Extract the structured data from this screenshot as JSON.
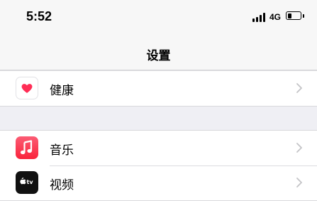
{
  "status_bar": {
    "time": "5:52",
    "network": "4G",
    "signal_bars": 4,
    "battery_level": 0.35
  },
  "nav": {
    "title": "设置"
  },
  "sections": [
    {
      "items": [
        {
          "label": "健康",
          "icon": "health-heart-icon"
        }
      ]
    },
    {
      "items": [
        {
          "label": "音乐",
          "icon": "music-note-icon"
        },
        {
          "label": "视频",
          "icon": "apple-tv-icon"
        }
      ]
    }
  ],
  "colors": {
    "music_red": "#fa233b",
    "health_pink": "#ff2d55",
    "background": "#efeff4"
  }
}
